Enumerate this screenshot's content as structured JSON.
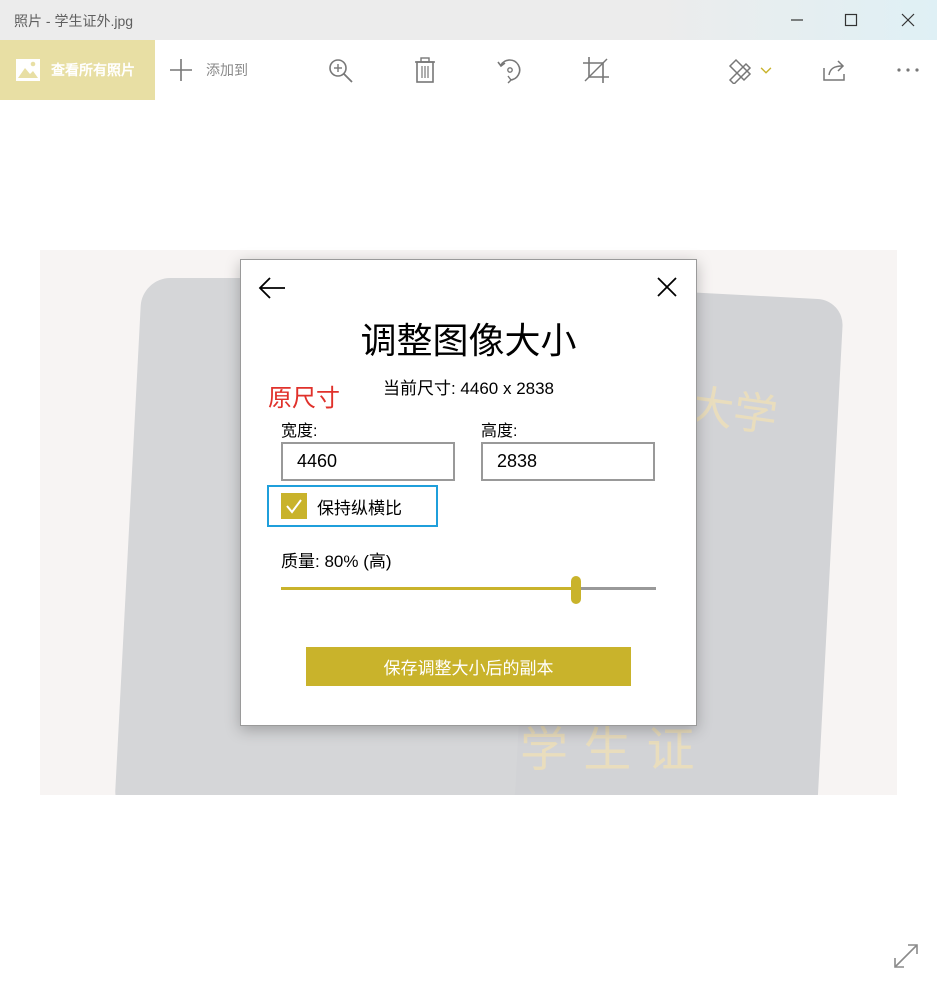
{
  "window": {
    "title": "照片 - 学生证外.jpg"
  },
  "toolbar": {
    "view_all_label": "查看所有照片",
    "add_to_label": "添加到",
    "icons": [
      "photos-icon",
      "plus-icon",
      "zoom-icon",
      "delete-icon",
      "rotate-icon",
      "crop-icon",
      "edit-icon",
      "chevron-down-icon",
      "share-icon",
      "more-icon"
    ]
  },
  "photo": {
    "gold_text_1": "大学",
    "gold_text_2": "学 生 证"
  },
  "dialog": {
    "title": "调整图像大小",
    "current_size": "当前尺寸: 4460 x 2838",
    "annotation": "原尺寸",
    "width_label": "宽度:",
    "width_value": "4460",
    "height_label": "高度:",
    "height_value": "2838",
    "aspect_label": "保持纵横比",
    "aspect_checked": true,
    "quality_label": "质量: 80% (高)",
    "quality_value": 0.8,
    "save_label": "保存调整大小后的副本"
  },
  "colors": {
    "accent": "#c9b32b",
    "view_all_bg": "#e8dfa4",
    "focus_border": "#1f9fdb",
    "annotation": "#e0312b"
  }
}
